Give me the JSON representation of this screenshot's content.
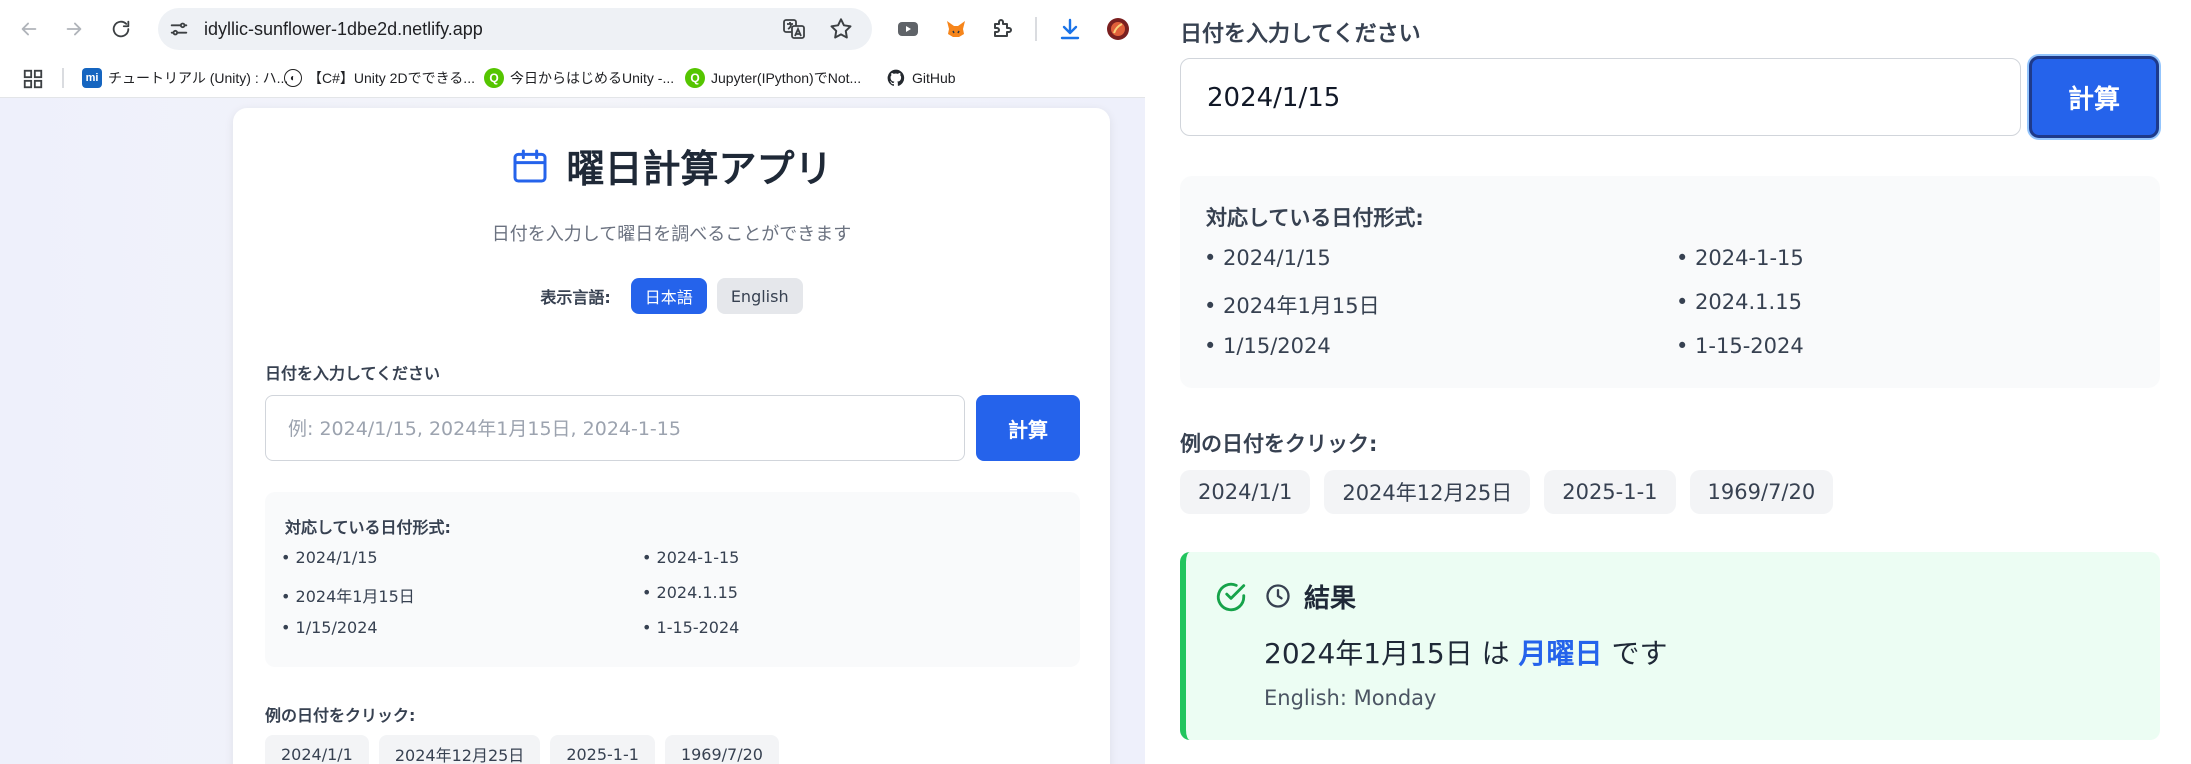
{
  "browser": {
    "url": "idyllic-sunflower-1dbe2d.netlify.app",
    "bookmarks": [
      {
        "label": "チュートリアル (Unity) : ハ...",
        "icon": "mi-icon",
        "color": "#1565c0",
        "glyph": "mi"
      },
      {
        "label": "【C#】Unity 2Dでできる...",
        "icon": "unity-icon",
        "color": "#222222",
        "glyph": "◐"
      },
      {
        "label": "今日からはじめるUnity -...",
        "icon": "qiita-search-icon",
        "color": "#55c500",
        "glyph": "Q"
      },
      {
        "label": "Jupyter(IPython)でNot...",
        "icon": "qiita-search-icon",
        "color": "#55c500",
        "glyph": "Q"
      },
      {
        "label": "GitHub",
        "icon": "github-icon",
        "color": "#24292f",
        "glyph": "●"
      }
    ]
  },
  "app": {
    "title": "曜日計算アプリ",
    "subtitle": "日付を入力して曜日を調べることができます",
    "language_label": "表示言語:",
    "languages": {
      "ja": "日本語",
      "en": "English"
    },
    "input_label": "日付を入力してください",
    "input_placeholder": "例: 2024/1/15, 2024年1月15日, 2024-1-15",
    "calc_button": "計算",
    "formats_title": "対応している日付形式:",
    "formats": [
      "• 2024/1/15",
      "• 2024-1-15",
      "• 2024年1月15日",
      "• 2024.1.15",
      "• 1/15/2024",
      "• 1-15-2024"
    ],
    "examples_label": "例の日付をクリック:",
    "examples": [
      "2024/1/1",
      "2024年12月25日",
      "2025-1-1",
      "1969/7/20"
    ]
  },
  "zoomed": {
    "input_value": "2024/1/15",
    "result": {
      "title": "結果",
      "date": "2024年1月15日",
      "particle": "は",
      "weekday": "月曜日",
      "suffix": "です",
      "english": "English: Monday"
    }
  },
  "colors": {
    "accent": "#2563eb",
    "success": "#22c55e",
    "result_bg": "#ecfdf3"
  }
}
